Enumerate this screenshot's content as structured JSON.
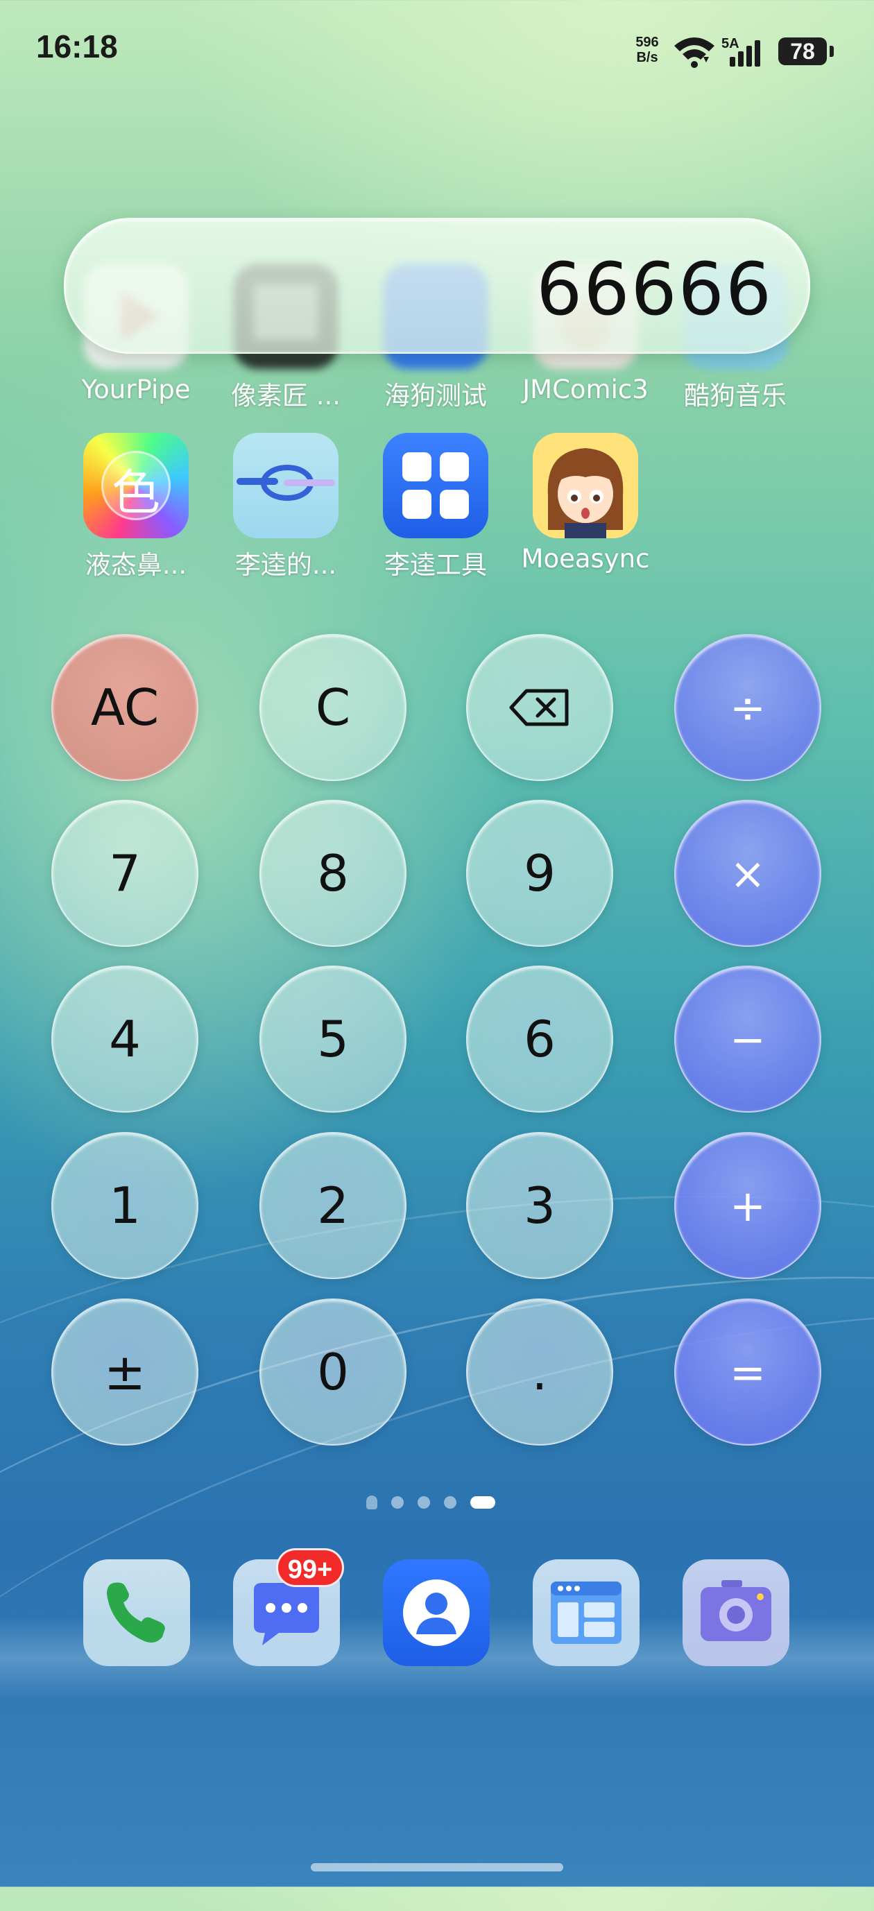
{
  "status_bar": {
    "time": "16:18",
    "net_speed_value": "596",
    "net_speed_unit": "B/s",
    "signal_label": "5A",
    "battery": "78"
  },
  "apps_row1": [
    {
      "label": "YourPipe"
    },
    {
      "label": "像素匠 ..."
    },
    {
      "label": "海狗测试"
    },
    {
      "label": "JMComic3"
    },
    {
      "label": "酷狗音乐"
    }
  ],
  "apps_row2": [
    {
      "label": "液态鼻...",
      "glyph": "色"
    },
    {
      "label": "李逵的..."
    },
    {
      "label": "李逵工具"
    },
    {
      "label": "Moeasync"
    }
  ],
  "calculator": {
    "display": "66666",
    "keys": {
      "ac": "AC",
      "c": "C",
      "divide": "÷",
      "seven": "7",
      "eight": "8",
      "nine": "9",
      "multiply": "×",
      "four": "4",
      "five": "5",
      "six": "6",
      "minus": "−",
      "one": "1",
      "two": "2",
      "three": "3",
      "plus": "+",
      "plusminus": "±",
      "zero": "0",
      "decimal": ".",
      "equals": "="
    },
    "backspace_icon": "backspace-icon"
  },
  "dock": {
    "messages_badge": "99+",
    "icons": [
      "phone-icon",
      "messages-icon",
      "contacts-icon",
      "browser-icon",
      "camera-icon"
    ]
  },
  "colors": {
    "operator_key": "#7480f0",
    "ac_key": "#d98c82",
    "badge": "#f22a2a"
  }
}
